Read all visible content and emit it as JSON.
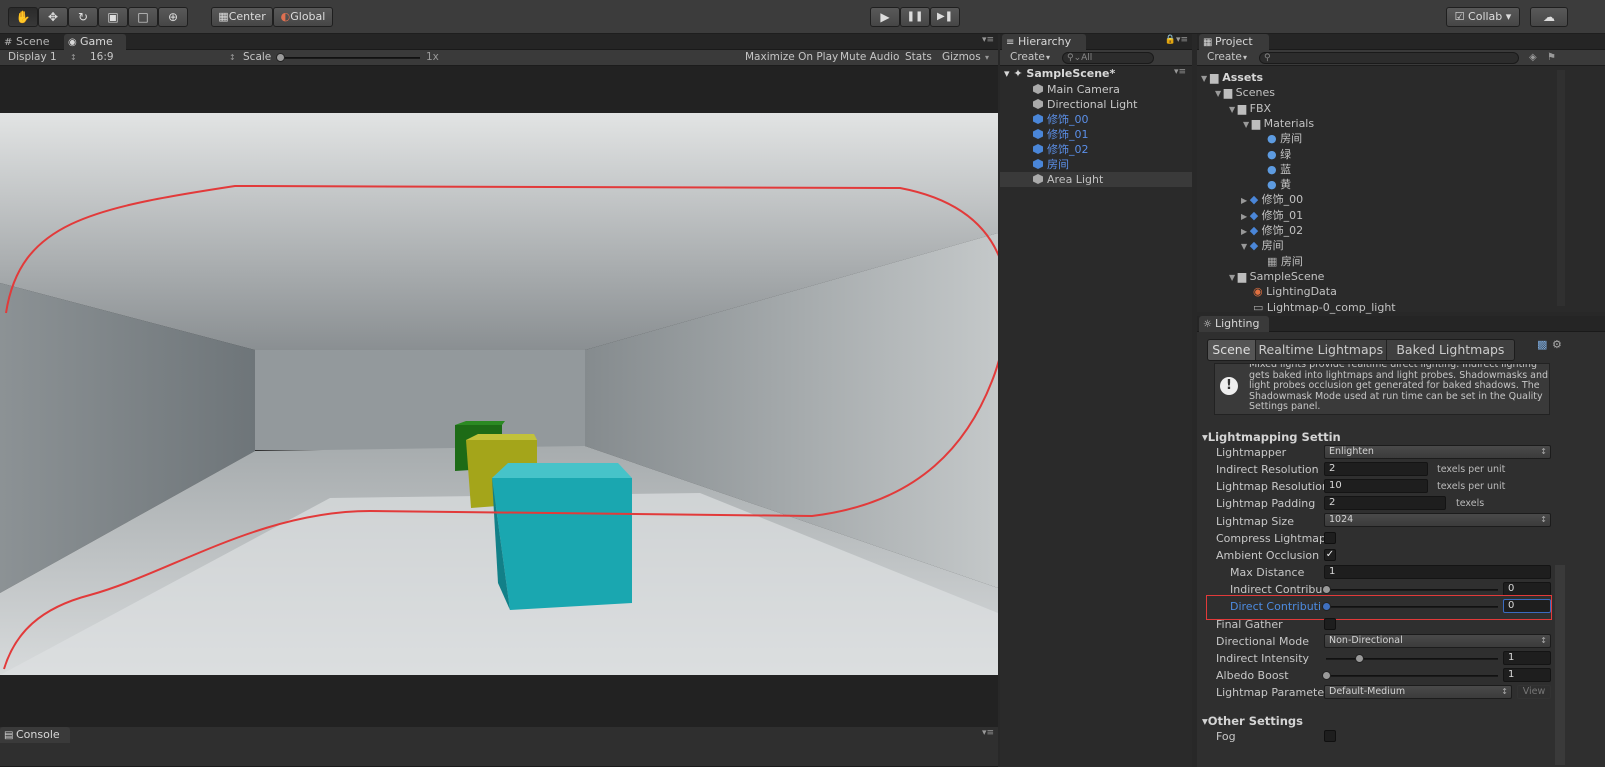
{
  "toolbar": {
    "tools": [
      "hand-tool-icon",
      "move-tool-icon",
      "rotate-tool-icon",
      "scale-tool-icon",
      "rect-tool-icon",
      "transform-tool-icon"
    ],
    "pivot_label": "Center",
    "space_label": "Global",
    "play": "▶",
    "pause": "❚❚",
    "step": "▶❚",
    "collab_label": "Collab",
    "cloud": "☁"
  },
  "game": {
    "tab_scene": "Scene",
    "tab_game": "Game",
    "display": "Display 1",
    "aspect": "16:9",
    "scale_label": "Scale",
    "scale_value": "1x",
    "maximize": "Maximize On Play",
    "mute": "Mute Audio",
    "stats": "Stats",
    "gizmos": "Gizmos"
  },
  "hierarchy": {
    "tab": "Hierarchy",
    "create": "Create",
    "search_placeholder": "All",
    "scene": "SampleScene*",
    "items": [
      {
        "label": "Main Camera",
        "prefab": false
      },
      {
        "label": "Directional Light",
        "prefab": false
      },
      {
        "label": "修饰_00",
        "prefab": true
      },
      {
        "label": "修饰_01",
        "prefab": true
      },
      {
        "label": "修饰_02",
        "prefab": true
      },
      {
        "label": "房间",
        "prefab": true
      },
      {
        "label": "Area Light",
        "prefab": false
      }
    ]
  },
  "project": {
    "tab": "Project",
    "create": "Create",
    "tree": {
      "assets": "Assets",
      "scenes": "Scenes",
      "fbx": "FBX",
      "materials": "Materials",
      "mats": [
        "房间",
        "绿",
        "蓝",
        "黄"
      ],
      "models": [
        "修饰_00",
        "修饰_01",
        "修饰_02",
        "房间"
      ],
      "mesh": "房间",
      "sample_scene": "SampleScene",
      "lighting_data": "LightingData",
      "lightmap": "Lightmap-0_comp_light"
    }
  },
  "lighting": {
    "tab": "Lighting",
    "tabs": [
      "Scene",
      "Realtime Lightmaps",
      "Baked Lightmaps"
    ],
    "info": "Mixed lights provide realtime direct lighting. Indirect lighting gets baked into lightmaps and light probes. Shadowmasks and light probes occlusion get generated for baked shadows. The Shadowmask Mode used at run time can be set in the Quality Settings panel.",
    "section1": "Lightmapping Settin",
    "lightmapper_label": "Lightmapper",
    "lightmapper_value": "Enlighten",
    "indirect_res_label": "Indirect Resolution",
    "indirect_res_value": "2",
    "texels_per_unit": "texels per unit",
    "lightmap_res_label": "Lightmap Resolution",
    "lightmap_res_value": "10",
    "padding_label": "Lightmap Padding",
    "padding_value": "2",
    "texels": "texels",
    "size_label": "Lightmap Size",
    "size_value": "1024",
    "compress_label": "Compress Lightmap",
    "compress_checked": false,
    "ao_label": "Ambient Occlusion",
    "ao_checked": true,
    "ao_check": "✓",
    "max_distance_label": "Max Distance",
    "max_distance_value": "1",
    "indirect_contrib_label": "Indirect Contribu",
    "indirect_contrib_value": "0",
    "direct_contrib_label": "Direct Contributi",
    "direct_contrib_value": "0",
    "final_gather_label": "Final Gather",
    "final_gather_checked": false,
    "dir_mode_label": "Directional Mode",
    "dir_mode_value": "Non-Directional",
    "indirect_intensity_label": "Indirect Intensity",
    "indirect_intensity_value": "1",
    "albedo_label": "Albedo Boost",
    "albedo_value": "1",
    "params_label": "Lightmap Paramete",
    "params_value": "Default-Medium",
    "view_label": "View",
    "section2": "Other Settings",
    "fog_label": "Fog",
    "fog_checked": false
  },
  "console": {
    "tab": "Console"
  },
  "colors": {
    "annotation": "#e23a3a",
    "prefab_text": "#5b8fe8",
    "selection": "#3a5f9a",
    "cyan_cube": "#1aa7b0",
    "yellow_cube": "#a4a51a",
    "green_cube": "#1d6b16"
  }
}
